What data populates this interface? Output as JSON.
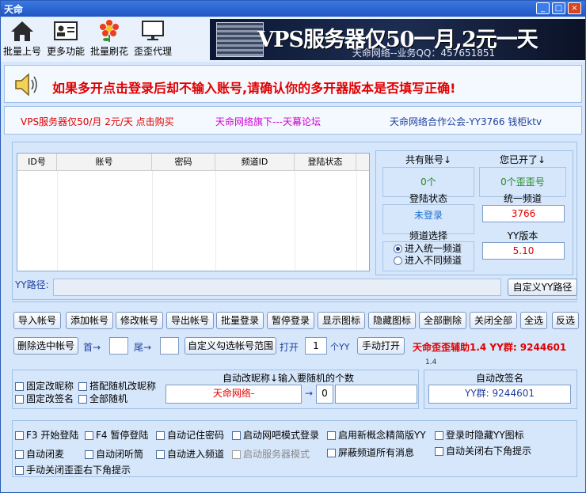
{
  "window": {
    "title": "天命",
    "min": "_",
    "max": "□",
    "close": "×"
  },
  "toolbar": {
    "items": [
      {
        "label": "批量上号",
        "icon": "home-icon"
      },
      {
        "label": "更多功能",
        "icon": "id-card-icon"
      },
      {
        "label": "批量刷花",
        "icon": "flower-icon"
      },
      {
        "label": "歪歪代理",
        "icon": "monitor-icon"
      }
    ],
    "banner_big": "VPS服务器仅50一月,2元一天",
    "banner_small": "天命网络--业务QQ：457651851"
  },
  "notice": {
    "text": "如果多开点击登录后却不输入账号,请确认你的多开器版本是否填写正确!"
  },
  "links": {
    "vps": "VPS服务器仅50/月 2元/天 点击购买",
    "forum": "天命网络旗下---天幕论坛",
    "guild": "天命网络合作公会-YY3766 钱柜ktv"
  },
  "colors": {
    "red": "#e00000",
    "blue": "#1f3f9f",
    "purple": "#d000d0",
    "green": "#1f8a1f"
  },
  "grid": {
    "columns": [
      "ID号",
      "账号",
      "密码",
      "频道ID",
      "登陆状态"
    ]
  },
  "stats": {
    "total_label": "共有账号↓",
    "total_value": "0个",
    "opened_label": "您已开了↓",
    "opened_value": "0个歪歪号",
    "login_label": "登陆状态",
    "login_value": "未登录",
    "unified_label": "统一频道",
    "unified_value": "3766",
    "channel_label": "频道选择",
    "radio_unified": "进入统一频道",
    "radio_diff": "进入不同频道",
    "yyver_label": "YY版本",
    "yyver_value": "5.10"
  },
  "path": {
    "label": "YY路径:",
    "value": "",
    "custom_button": "自定义YY路径"
  },
  "buttons": {
    "import": "导入帐号",
    "add": "添加帐号",
    "edit": "修改帐号",
    "export": "导出帐号",
    "batch_login": "批量登录",
    "pause_login": "暂停登录",
    "show_icon": "显示图标",
    "hide_icon": "隐藏图标",
    "delete_all": "全部删除",
    "close_all": "关闭全部",
    "select_all": "全选",
    "invert": "反选",
    "delete_selected": "删除选中帐号",
    "custom_range": "自定义勾选帐号范围",
    "manual_open": "手动打开"
  },
  "range": {
    "head_label": "首→",
    "head_value": "",
    "tail_label": "尾→",
    "tail_value": "",
    "open_label": "打开",
    "open_count": "1",
    "unit": "个YY"
  },
  "promo": {
    "text": "天命歪歪辅助1.4 YY群: 9244601",
    "version_tag": "1.4"
  },
  "nick": {
    "title": "自动改昵称↓输入要随机的个数",
    "fixed_nick": "固定改昵称",
    "rand_nick": "搭配随机改昵称",
    "fixed_sign": "固定改签名",
    "all_random": "全部随机",
    "nick_value": "天命网络-",
    "arrow": "→",
    "random_count": "0",
    "extra": ""
  },
  "sign": {
    "title": "自动改签名",
    "value": "YY群: 9244601"
  },
  "options": [
    {
      "label": "F3 开始登陆",
      "disabled": false
    },
    {
      "label": "F4 暂停登陆",
      "disabled": false
    },
    {
      "label": "自动记住密码",
      "disabled": false
    },
    {
      "label": "启动网吧模式登录",
      "disabled": false
    },
    {
      "label": "启用新概念精简版YY",
      "disabled": false
    },
    {
      "label": "登录时隐藏YY图标",
      "disabled": false
    },
    {
      "label": "自动闭麦",
      "disabled": false
    },
    {
      "label": "自动闭听筒",
      "disabled": false
    },
    {
      "label": "自动进入频道",
      "disabled": false
    },
    {
      "label": "启动服务器模式",
      "disabled": true
    },
    {
      "label": "屏蔽频道所有消息",
      "disabled": false
    },
    {
      "label": "自动关闭右下角提示",
      "disabled": false
    },
    {
      "label": "手动关闭歪歪右下角提示",
      "disabled": false
    }
  ]
}
